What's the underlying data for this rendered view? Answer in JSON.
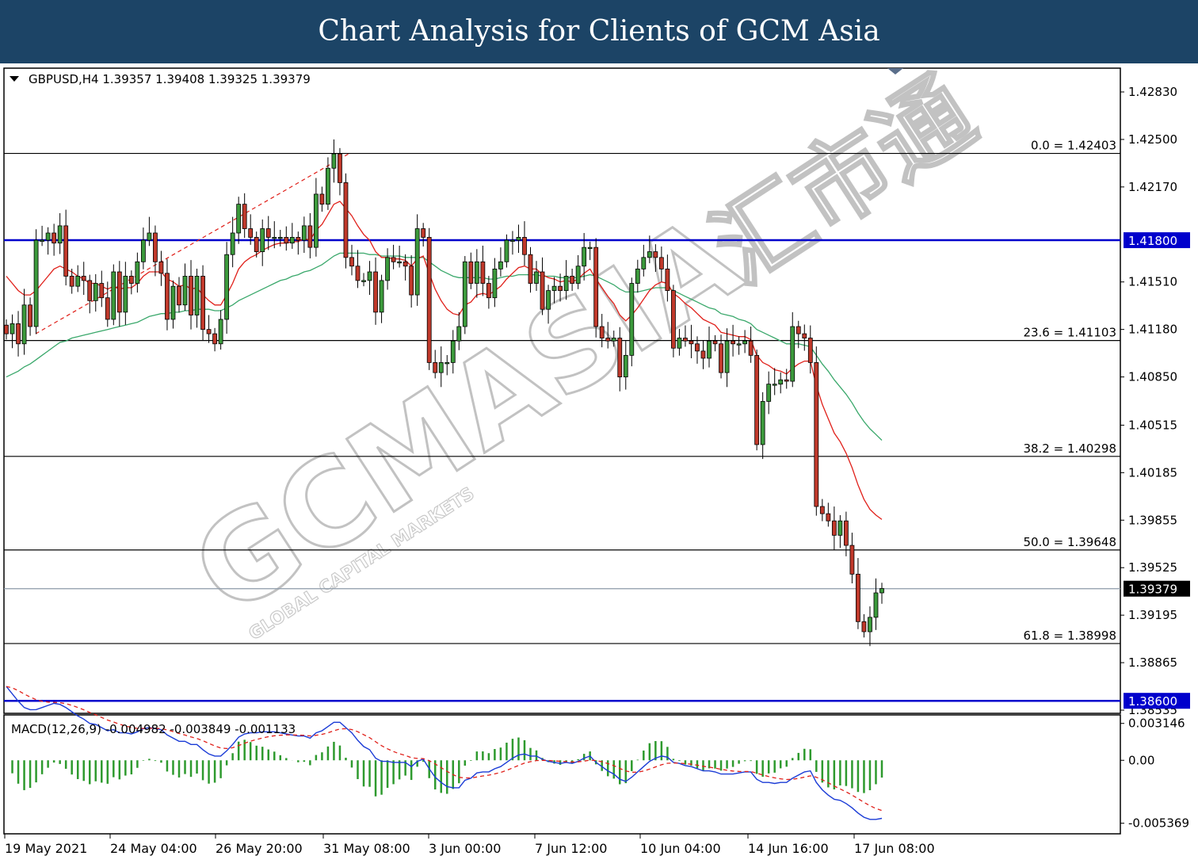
{
  "header": {
    "title": "Chart Analysis for Clients of GCM Asia"
  },
  "watermark": {
    "main": "GCMASIA",
    "chinese": "汇市通",
    "sub": "GLOBAL CAPITAL MARKETS"
  },
  "chart_data": {
    "type": "candlestick",
    "symbol": "GBPUSD",
    "timeframe": "H4",
    "info_line": "GBPUSD,H4  1.39357 1.39408 1.39325 1.39379",
    "ohlc": [
      1.39357,
      1.39408,
      1.39325,
      1.39379
    ],
    "price_range": [
      1.3845,
      1.4304
    ],
    "price_ticks": [
      "1.42830",
      "1.42500",
      "1.42170",
      "1.41510",
      "1.41180",
      "1.40850",
      "1.40515",
      "1.40185",
      "1.39855",
      "1.39525",
      "1.39195",
      "1.38865",
      "1.38535"
    ],
    "x_labels": [
      "19 May 2021",
      "24 May 04:00",
      "26 May 20:00",
      "31 May 08:00",
      "3 Jun 00:00",
      "7 Jun 12:00",
      "10 Jun 04:00",
      "14 Jun 16:00",
      "17 Jun 08:00"
    ],
    "current_price": "1.39379",
    "horizontal_lines": [
      {
        "label": "1.41800",
        "value": 1.418,
        "color": "#0000cc"
      },
      {
        "label": "1.38600",
        "value": 1.386,
        "color": "#0000cc"
      }
    ],
    "fibonacci": [
      {
        "level": "0.0",
        "price": "1.42403",
        "text": "0.0 = 1.42403"
      },
      {
        "level": "23.6",
        "price": "1.41103",
        "text": "23.6 = 1.41103"
      },
      {
        "level": "38.2",
        "price": "1.40298",
        "text": "38.2 = 1.40298"
      },
      {
        "level": "50.0",
        "price": "1.39648",
        "text": "50.0 = 1.39648"
      },
      {
        "level": "61.8",
        "price": "1.38998",
        "text": "61.8 = 1.38998"
      }
    ],
    "close_series": [
      1.4115,
      1.4122,
      1.4108,
      1.4135,
      1.412,
      1.418,
      1.418,
      1.4185,
      1.4178,
      1.419,
      1.4155,
      1.4148,
      1.4155,
      1.4152,
      1.4138,
      1.415,
      1.414,
      1.4125,
      1.4158,
      1.413,
      1.4155,
      1.415,
      1.4165,
      1.418,
      1.4185,
      1.4165,
      1.4157,
      1.4125,
      1.4148,
      1.4135,
      1.4155,
      1.4128,
      1.4155,
      1.4118,
      1.4115,
      1.4108,
      1.4125,
      1.417,
      1.4185,
      1.4205,
      1.4188,
      1.4182,
      1.4172,
      1.4188,
      1.4182,
      1.4182,
      1.4182,
      1.4178,
      1.4182,
      1.418,
      1.419,
      1.4175,
      1.4212,
      1.4205,
      1.423,
      1.424,
      1.422,
      1.4168,
      1.4162,
      1.4152,
      1.4152,
      1.4158,
      1.413,
      1.4152,
      1.4168,
      1.4165,
      1.4165,
      1.4162,
      1.4142,
      1.4188,
      1.4182,
      1.4095,
      1.4088,
      1.4095,
      1.4095,
      1.411,
      1.412,
      1.4165,
      1.415,
      1.4165,
      1.415,
      1.414,
      1.416,
      1.4165,
      1.418,
      1.418,
      1.4182,
      1.417,
      1.415,
      1.4158,
      1.4132,
      1.4145,
      1.4148,
      1.4145,
      1.4155,
      1.415,
      1.4162,
      1.4175,
      1.4175,
      1.412,
      1.4112,
      1.411,
      1.4112,
      1.4085,
      1.41,
      1.415,
      1.416,
      1.4168,
      1.4172,
      1.4168,
      1.416,
      1.4145,
      1.4105,
      1.4112,
      1.411,
      1.4108,
      1.4103,
      1.4098,
      1.411,
      1.4108,
      1.4088,
      1.411,
      1.4108,
      1.4108,
      1.411,
      1.41,
      1.4038,
      1.4068,
      1.408,
      1.408,
      1.4083,
      1.4082,
      1.412,
      1.4115,
      1.4112,
      1.4095,
      1.3995,
      1.399,
      1.3985,
      1.3975,
      1.3985,
      1.3968,
      1.3948,
      1.3915,
      1.3908,
      1.3918,
      1.3935,
      1.3938
    ],
    "ma_fast": [
      1.4155,
      1.415,
      1.4145,
      1.4142,
      1.4142,
      1.4145,
      1.415,
      1.4155,
      1.416,
      1.4162,
      1.416,
      1.4158,
      1.4155,
      1.4153,
      1.415,
      1.415,
      1.4148,
      1.4146,
      1.4148,
      1.4146,
      1.4147,
      1.4147,
      1.415,
      1.4155,
      1.4158,
      1.4158,
      1.4158,
      1.4153,
      1.4151,
      1.4148,
      1.4149,
      1.4146,
      1.4147,
      1.4142,
      1.4138,
      1.4135,
      1.4135,
      1.4142,
      1.415,
      1.416,
      1.4165,
      1.4168,
      1.417,
      1.4173,
      1.4175,
      1.4177,
      1.4178,
      1.4178,
      1.4179,
      1.4179,
      1.4181,
      1.418,
      1.4187,
      1.4191,
      1.4198,
      1.4205,
      1.4207,
      1.4202,
      1.4197,
      1.419,
      1.4184,
      1.418,
      1.4172,
      1.4168,
      1.4168,
      1.4167,
      1.4167,
      1.4166,
      1.4162,
      1.4167,
      1.4169,
      1.4157,
      1.4146,
      1.4138,
      1.4132,
      1.4129,
      1.4128,
      1.4135,
      1.4137,
      1.4142,
      1.4143,
      1.4142,
      1.4145,
      1.4148,
      1.4153,
      1.4157,
      1.4161,
      1.4162,
      1.416,
      1.416,
      1.4156,
      1.4154,
      1.4153,
      1.4151,
      1.4152,
      1.4151,
      1.4153,
      1.4157,
      1.416,
      1.4153,
      1.4147,
      1.4141,
      1.4136,
      1.4128,
      1.4124,
      1.4128,
      1.4133,
      1.4139,
      1.4145,
      1.4149,
      1.4151,
      1.415,
      1.4143,
      1.414,
      1.4136,
      1.4133,
      1.4129,
      1.4125,
      1.4123,
      1.4121,
      1.4116,
      1.4115,
      1.4114,
      1.4113,
      1.4113,
      1.4111,
      1.41,
      1.4095,
      1.4093,
      1.409,
      1.4089,
      1.4087,
      1.4091,
      1.4094,
      1.4096,
      1.4096,
      1.4079,
      1.4066,
      1.4056,
      1.4046,
      1.404,
      1.4032,
      1.4022,
      1.401,
      1.4,
      1.3993,
      1.3989,
      1.3986
    ],
    "ma_slow": [
      1.4085,
      1.4087,
      1.4089,
      1.4092,
      1.4094,
      1.4097,
      1.41,
      1.4103,
      1.4106,
      1.4109,
      1.411,
      1.4112,
      1.4113,
      1.4114,
      1.4115,
      1.4116,
      1.4117,
      1.4118,
      1.4119,
      1.412,
      1.4121,
      1.4122,
      1.4123,
      1.4125,
      1.4127,
      1.4128,
      1.4129,
      1.4129,
      1.413,
      1.413,
      1.4131,
      1.4131,
      1.4132,
      1.4132,
      1.4132,
      1.4131,
      1.4131,
      1.4133,
      1.4135,
      1.4138,
      1.414,
      1.4142,
      1.4144,
      1.4146,
      1.4148,
      1.415,
      1.4152,
      1.4153,
      1.4155,
      1.4156,
      1.4158,
      1.4159,
      1.4161,
      1.4163,
      1.4166,
      1.4169,
      1.4171,
      1.4171,
      1.4171,
      1.4171,
      1.4171,
      1.417,
      1.417,
      1.4169,
      1.4169,
      1.4169,
      1.4169,
      1.4168,
      1.4168,
      1.4168,
      1.4168,
      1.4165,
      1.4162,
      1.4159,
      1.4157,
      1.4155,
      1.4154,
      1.4154,
      1.4154,
      1.4154,
      1.4154,
      1.4153,
      1.4153,
      1.4154,
      1.4155,
      1.4155,
      1.4156,
      1.4156,
      1.4156,
      1.4156,
      1.4155,
      1.4155,
      1.4155,
      1.4154,
      1.4154,
      1.4154,
      1.4154,
      1.4155,
      1.4156,
      1.4155,
      1.4153,
      1.4151,
      1.4149,
      1.4146,
      1.4144,
      1.4144,
      1.4144,
      1.4145,
      1.4146,
      1.4147,
      1.4147,
      1.4147,
      1.4145,
      1.4143,
      1.4141,
      1.4139,
      1.4137,
      1.4135,
      1.4133,
      1.4132,
      1.4129,
      1.4128,
      1.4127,
      1.4125,
      1.4124,
      1.4122,
      1.4118,
      1.4116,
      1.4114,
      1.4112,
      1.411,
      1.4108,
      1.4108,
      1.4108,
      1.4107,
      1.4106,
      1.41,
      1.4094,
      1.4089,
      1.4083,
      1.4078,
      1.4073,
      1.4067,
      1.406,
      1.4054,
      1.4049,
      1.4045,
      1.4041
    ],
    "macd": {
      "label": "MACD(12,26,9) -0.004982 -0.003849 -0.001133",
      "params": [
        12,
        26,
        9
      ],
      "values": [
        -0.004982,
        -0.003849,
        -0.001133
      ],
      "range": [
        -0.006,
        0.0036
      ],
      "ticks": [
        "0.003146",
        "0.00",
        "-0.005369"
      ]
    }
  }
}
